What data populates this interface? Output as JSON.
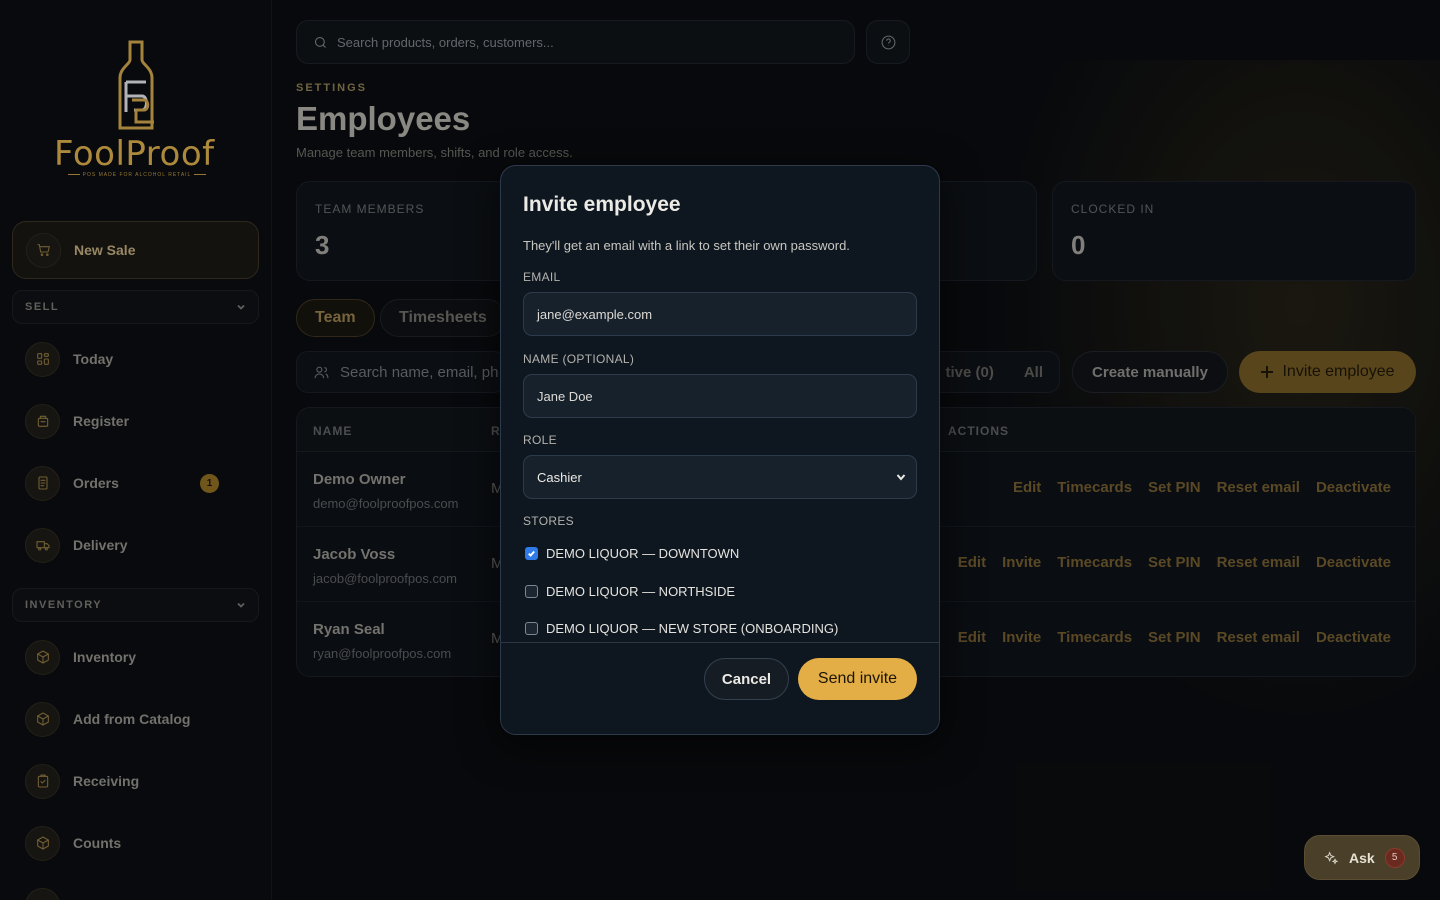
{
  "brand": {
    "name": "FoolProof",
    "tagline": "POS MADE FOR ALCOHOL RETAIL"
  },
  "sidebar": {
    "new_sale": "New Sale",
    "sections": [
      {
        "label": "SELL",
        "items": [
          {
            "label": "Today",
            "icon": "grid-icon"
          },
          {
            "label": "Register",
            "icon": "register-icon"
          },
          {
            "label": "Orders",
            "icon": "receipt-icon",
            "badge": "1"
          },
          {
            "label": "Delivery",
            "icon": "truck-icon"
          }
        ]
      },
      {
        "label": "INVENTORY",
        "items": [
          {
            "label": "Inventory",
            "icon": "box-icon"
          },
          {
            "label": "Add from Catalog",
            "icon": "box-icon"
          },
          {
            "label": "Receiving",
            "icon": "clipboard-icon"
          },
          {
            "label": "Counts",
            "icon": "box-icon"
          }
        ]
      }
    ]
  },
  "search": {
    "placeholder": "Search products, orders, customers..."
  },
  "page": {
    "eyebrow": "SETTINGS",
    "title": "Employees",
    "subtitle": "Manage team members, shifts, and role access."
  },
  "stats": [
    {
      "label": "TEAM MEMBERS",
      "value": "3"
    },
    {
      "label": "CLOCKED IN",
      "value": "0"
    }
  ],
  "tabs": [
    {
      "label": "Team",
      "active": true
    },
    {
      "label": "Timesheets",
      "active": false
    }
  ],
  "filter": {
    "placeholder": "Search name, email, ph"
  },
  "segments": [
    "tive (0)",
    "All"
  ],
  "actions": {
    "create_manually": "Create manually",
    "invite_employee": "Invite employee"
  },
  "table": {
    "headers": {
      "name": "NAME",
      "role": "R",
      "actions": "ACTIONS"
    },
    "rows": [
      {
        "name": "Demo Owner",
        "email": "demo@foolproofpos.com",
        "role": "M",
        "actions": [
          "Edit",
          "Timecards",
          "Set PIN",
          "Reset email",
          "Deactivate"
        ]
      },
      {
        "name": "Jacob Voss",
        "email": "jacob@foolproofpos.com",
        "role": "M",
        "actions": [
          "Edit",
          "Invite",
          "Timecards",
          "Set PIN",
          "Reset email",
          "Deactivate"
        ]
      },
      {
        "name": "Ryan Seal",
        "email": "ryan@foolproofpos.com",
        "role": "M",
        "actions": [
          "Edit",
          "Invite",
          "Timecards",
          "Set PIN",
          "Reset email",
          "Deactivate"
        ]
      }
    ]
  },
  "modal": {
    "title": "Invite employee",
    "description": "They'll get an email with a link to set their own password.",
    "email_label": "EMAIL",
    "email_placeholder": "jane@example.com",
    "name_label": "NAME (OPTIONAL)",
    "name_placeholder": "Jane Doe",
    "role_label": "ROLE",
    "role_value": "Cashier",
    "stores_label": "STORES",
    "stores": [
      {
        "label": "DEMO LIQUOR — DOWNTOWN",
        "checked": true
      },
      {
        "label": "DEMO LIQUOR — NORTHSIDE",
        "checked": false
      },
      {
        "label": "DEMO LIQUOR — NEW STORE (ONBOARDING)",
        "checked": false
      }
    ],
    "cancel": "Cancel",
    "send": "Send invite"
  },
  "ask": {
    "label": "Ask",
    "count": "5"
  },
  "colors": {
    "accent": "#e3ae45",
    "checkbox": "#2f7bea",
    "background": "#0a0c0f"
  }
}
